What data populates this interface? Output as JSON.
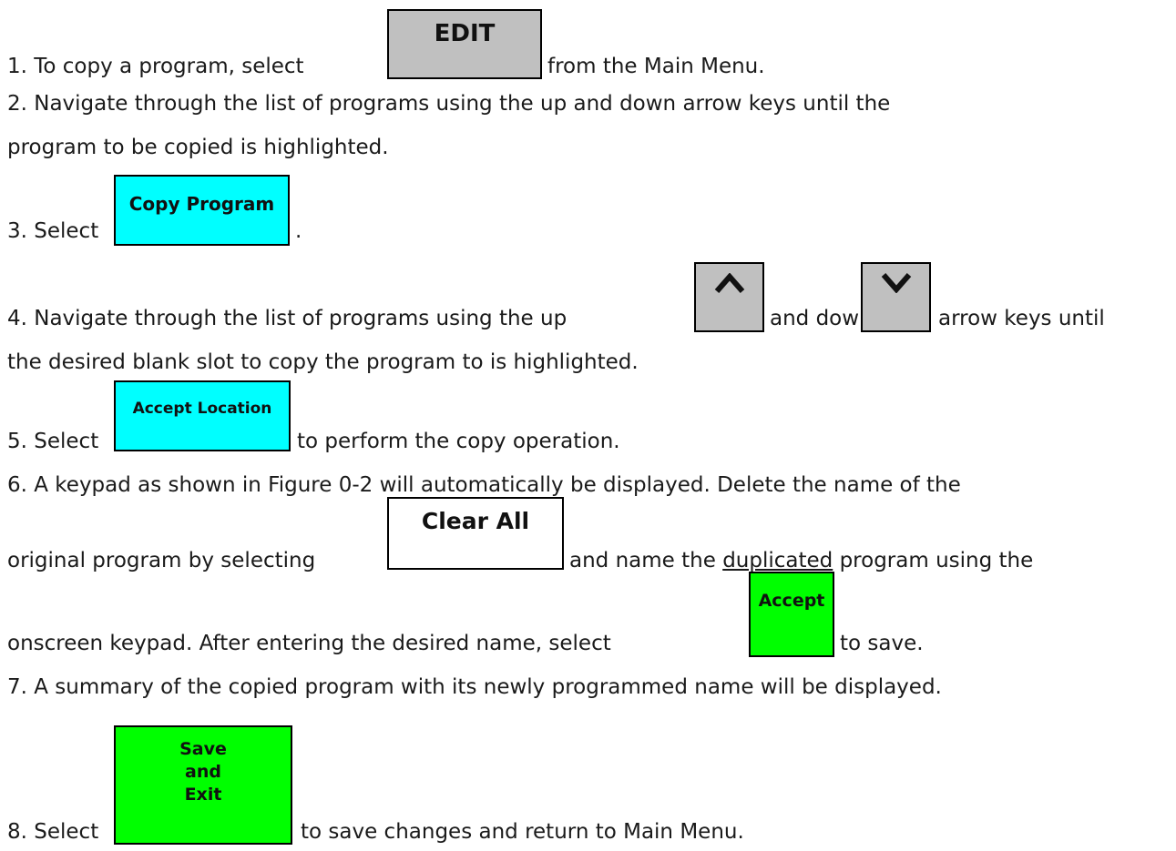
{
  "colors": {
    "gray": "#c0c0c0",
    "cyan": "#00ffff",
    "green": "#00ff00",
    "white": "#ffffff"
  },
  "step1": {
    "before": "1. To copy a program, select",
    "after": "from the Main Menu."
  },
  "buttons": {
    "edit": "EDIT",
    "copy_program": "Copy Program",
    "up_arrow": "^",
    "down_arrow": "v",
    "accept_location": "Accept Location",
    "clear_all": "Clear All",
    "accept": "Accept",
    "save_and_exit": [
      "Save",
      "and",
      "Exit"
    ]
  },
  "step2": {
    "line1": "2. Navigate through the list of programs using the up and down arrow keys until the",
    "line2": "program to be copied is highlighted."
  },
  "step3": {
    "before": "3. Select",
    "after": "."
  },
  "step4": {
    "before": "4. Navigate through the list of programs using the up",
    "middle": "and down",
    "after": "arrow keys until",
    "line2": "the desired blank slot to copy the program to is highlighted."
  },
  "step5": {
    "before": "5. Select",
    "after": "to perform the copy operation."
  },
  "step6": {
    "line1": "6. A keypad as shown in Figure 0-2 will automatically be displayed. Delete the name of the",
    "line2_before": "original program by selecting",
    "line2_after_a": "and name the ",
    "line2_after_u": "duplicated",
    "line2_after_b": " program using the",
    "line3_before": "onscreen keypad. After entering the desired name, select",
    "line3_after": "to save."
  },
  "step7": {
    "line1": "7. A summary of the copied program with its newly programmed name will be displayed."
  },
  "step8": {
    "before": "8. Select",
    "after": "to save changes and return to Main Menu."
  }
}
